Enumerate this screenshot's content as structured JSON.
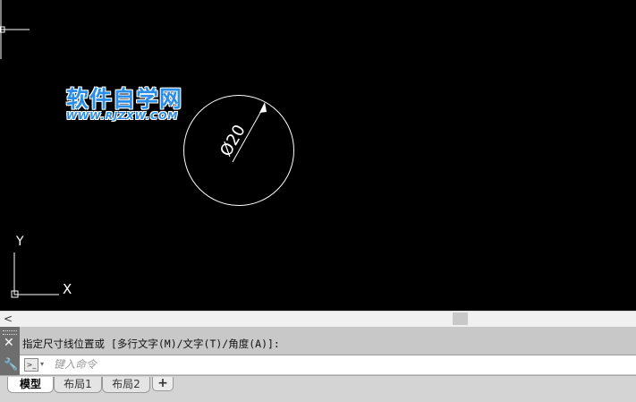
{
  "canvas": {
    "background": "#000000",
    "dimension_text": "Ø20",
    "ucs_icon": {
      "x_label": "X",
      "y_label": "Y"
    }
  },
  "watermark": {
    "title": "软件自学网",
    "url": "WWW.RJZXW.COM",
    "color": "#2a8ee8"
  },
  "scrollbar": {
    "left_arrow": "<"
  },
  "command_line": {
    "history": "指定尺寸线位置或 [多行文字(M)/文字(T)/角度(A)]:",
    "placeholder": "键入命令",
    "prompt_icon": ">_",
    "dropdown_icon": "▾",
    "close_icon": "✕",
    "customize_icon": "wrench-icon"
  },
  "layout_tabs": {
    "tabs": [
      "模型",
      "布局1",
      "布局2"
    ],
    "active": "模型",
    "add_label": "+"
  }
}
